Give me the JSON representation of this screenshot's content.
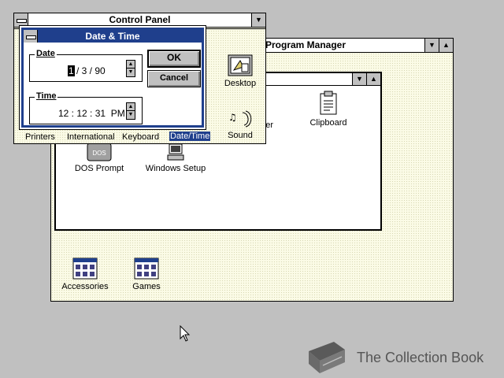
{
  "program_manager": {
    "title": "Program Manager"
  },
  "main_group": {
    "icons": {
      "dos_prompt": "DOS Prompt",
      "windows_setup": "Windows Setup",
      "clipboard": "Clipboard",
      "pif_editor_partial": "ager"
    }
  },
  "groups": {
    "accessories": "Accessories",
    "games": "Games"
  },
  "control_panel": {
    "title": "Control Panel",
    "icons": {
      "desktop": "Desktop",
      "sound": "Sound",
      "printers": "Printers",
      "international": "International",
      "keyboard": "Keyboard",
      "datetime": "Date/Time"
    }
  },
  "dialog": {
    "title": "Date & Time",
    "date_label": "Date",
    "date_month": "1",
    "date_rest": "/ 3 / 90",
    "time_label": "Time",
    "time_value": "12 : 12 : 31  PM",
    "ok": "OK",
    "cancel": "Cancel"
  },
  "watermark": {
    "text": "The Collection Book"
  },
  "colors": {
    "active_title": "#1f3f8c",
    "desktop": "#c0c0c0",
    "selection": "#1f3f8c"
  }
}
